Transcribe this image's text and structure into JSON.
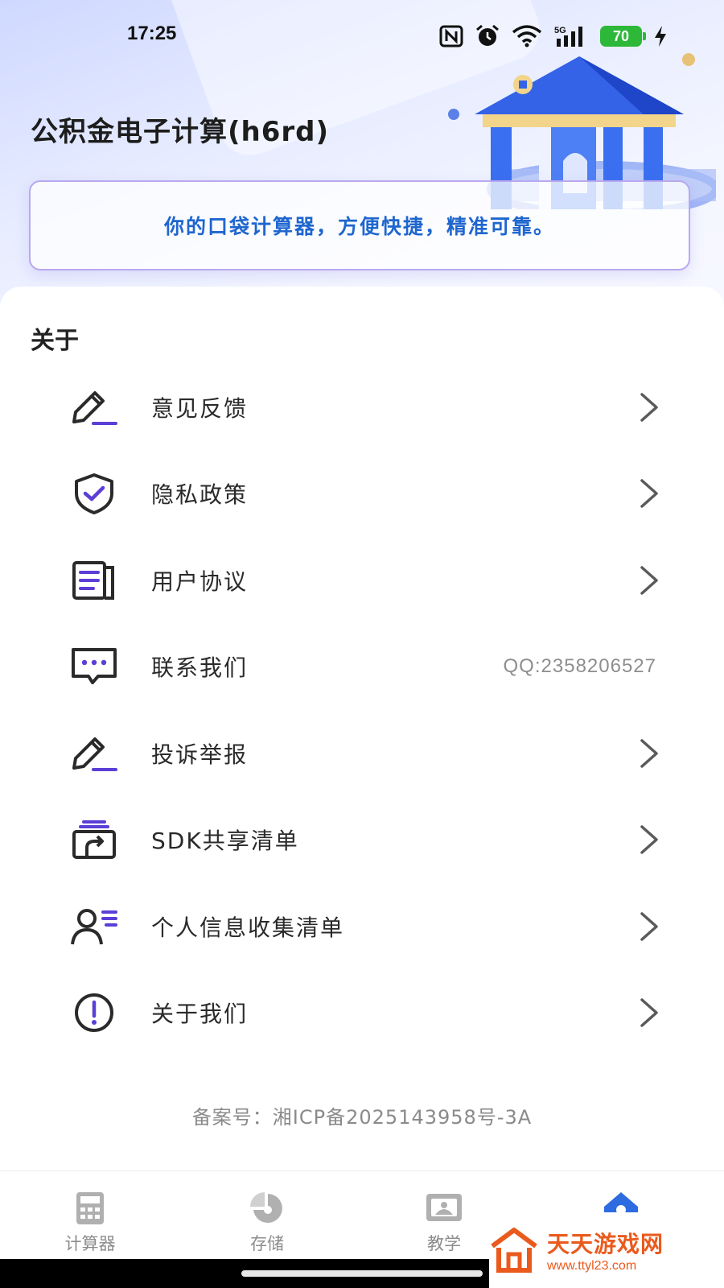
{
  "status_bar": {
    "time": "17:25",
    "battery_level": "70",
    "network": "5G",
    "icons": [
      "nfc-icon",
      "alarm-icon",
      "wifi-icon",
      "signal-5g-icon",
      "battery-icon",
      "charging-icon"
    ]
  },
  "header": {
    "title": "公积金电子计算(h6rd)",
    "slogan": "你的口袋计算器，方便快捷，精准可靠。"
  },
  "about": {
    "section_title": "关于",
    "items": [
      {
        "label": "意见反馈",
        "icon": "feedback-pen-icon",
        "value": "",
        "chevron": true
      },
      {
        "label": "隐私政策",
        "icon": "shield-check-icon",
        "value": "",
        "chevron": true
      },
      {
        "label": "用户协议",
        "icon": "document-icon",
        "value": "",
        "chevron": true
      },
      {
        "label": "联系我们",
        "icon": "chat-bubble-icon",
        "value": "QQ:2358206527",
        "chevron": false
      },
      {
        "label": "投诉举报",
        "icon": "report-pen-icon",
        "value": "",
        "chevron": true
      },
      {
        "label": "SDK共享清单",
        "icon": "share-list-icon",
        "value": "",
        "chevron": true
      },
      {
        "label": "个人信息收集清单",
        "icon": "user-list-icon",
        "value": "",
        "chevron": true
      },
      {
        "label": "关于我们",
        "icon": "info-alert-icon",
        "value": "",
        "chevron": true
      }
    ]
  },
  "footer": {
    "icp": "备案号：湘ICP备2025143958号-3A"
  },
  "tabbar": {
    "tabs": [
      {
        "label": "计算器",
        "icon": "calculator-icon",
        "active": false
      },
      {
        "label": "存储",
        "icon": "pie-chart-icon",
        "active": false
      },
      {
        "label": "教学",
        "icon": "video-lesson-icon",
        "active": false
      },
      {
        "label": "",
        "icon": "home-icon",
        "active": true
      }
    ]
  },
  "watermark": {
    "title": "天天游戏网",
    "url": "www.ttyl23.com"
  },
  "colors": {
    "accent_purple": "#5b3fd6",
    "slogan_blue": "#1f66cf",
    "tab_active_blue": "#2f6be0",
    "watermark_orange": "#ea5a1d"
  }
}
